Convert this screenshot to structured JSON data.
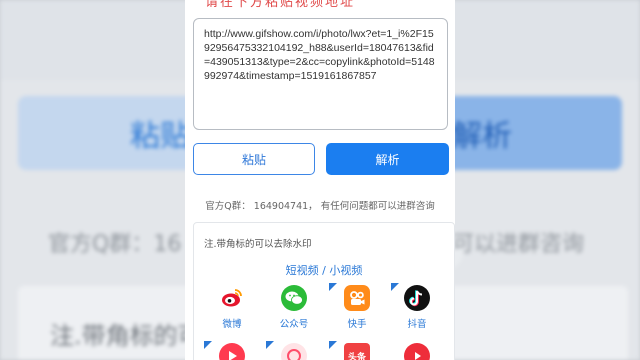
{
  "background": {
    "paste_label": "粘贴",
    "parse_label": "解析",
    "qq_left": "官方Q群：16",
    "qq_right": "可以进群咨询",
    "note": "注.带角标的可"
  },
  "top_strip_text": "请在下方粘贴视频地址",
  "url_input": {
    "value": "http://www.gifshow.com/i/photo/lwx?et=1_i%2F1592956475332104192_h88&userId=18047613&fid=439051313&type=2&cc=copylink&photoId=5148992974&timestamp=1519161867857"
  },
  "buttons": {
    "paste": "粘贴",
    "parse": "解析"
  },
  "qq_group": "官方Q群：  164904741，  有任何问题都可以进群咨询",
  "supported": {
    "note": "注.带角标的可以去除水印",
    "title": "短视频 / 小视频",
    "apps": [
      {
        "label": "微博",
        "icon": "weibo-icon"
      },
      {
        "label": "公众号",
        "icon": "wechat-icon"
      },
      {
        "label": "快手",
        "icon": "kuaishou-icon"
      },
      {
        "label": "抖音",
        "icon": "douyin-icon"
      }
    ],
    "row2_icons": [
      "red-app-icon",
      "pink-app-icon",
      "toutiao-icon",
      "red-play-icon"
    ],
    "toutiao_text": "头条"
  },
  "colors": {
    "accent": "#1b7ef0",
    "link": "#2a78d6"
  }
}
